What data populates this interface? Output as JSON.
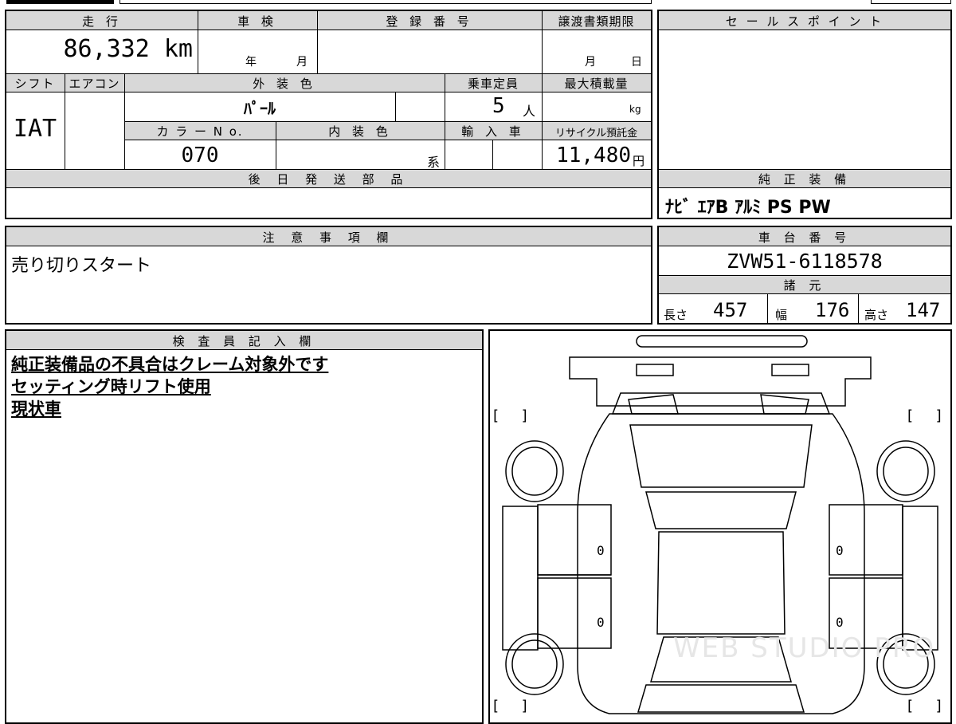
{
  "header": {
    "mileage_label": "走 行",
    "inspection_label": "車 検",
    "registration_label": "登 録 番 号",
    "transfer_deadline_label": "譲渡書類期限",
    "mileage_value": "86,332 km",
    "inspection_year_unit": "年",
    "inspection_month_unit": "月",
    "transfer_month_unit": "月",
    "transfer_day_unit": "日"
  },
  "specs": {
    "shift_label": "シフト",
    "aircon_label": "エアコン",
    "exterior_color_label": "外 装 色",
    "capacity_label": "乗車定員",
    "max_load_label": "最大積載量",
    "shift_value": "IAT",
    "exterior_color_value": "ﾊﾟｰﾙ",
    "capacity_value": "5",
    "capacity_unit": "人",
    "max_load_unit": "kg",
    "color_no_label": "カ ラ ー N o.",
    "interior_color_label": "内 装 色",
    "import_label": "輸 入 車",
    "recycle_label": "リサイクル預託金",
    "color_no_value": "070",
    "interior_color_unit": "系",
    "recycle_value": "11,480",
    "recycle_unit": "円"
  },
  "later_parts": {
    "label": "後 日 発 送 部 品",
    "value": ""
  },
  "sales_points": {
    "label": "セ ー ル ス ポ イ ン ト",
    "value": ""
  },
  "equipment": {
    "label": "純 正 装 備",
    "value": "ﾅﾋﾞ ｴｱB ｱﾙﾐ PS PW"
  },
  "notes": {
    "label": "注 意 事 項 欄",
    "value": "売り切りスタート"
  },
  "chassis": {
    "label": "車 台 番 号",
    "value": "ZVW51-6118578"
  },
  "dimensions": {
    "label": "諸 元",
    "length_label": "長さ",
    "length_value": "457",
    "width_label": "幅",
    "width_value": "176",
    "height_label": "高さ",
    "height_value": "147"
  },
  "inspector": {
    "label": "検 査 員 記 入 欄",
    "lines": [
      "純正装備品の不具合はクレーム対象外です",
      "セッティング時リフト使用",
      "現状車"
    ]
  },
  "diagram": {
    "bracket_open": "[",
    "bracket_close": "]",
    "zero_mark": "0",
    "watermark": "WEB STUDIO PRO"
  }
}
